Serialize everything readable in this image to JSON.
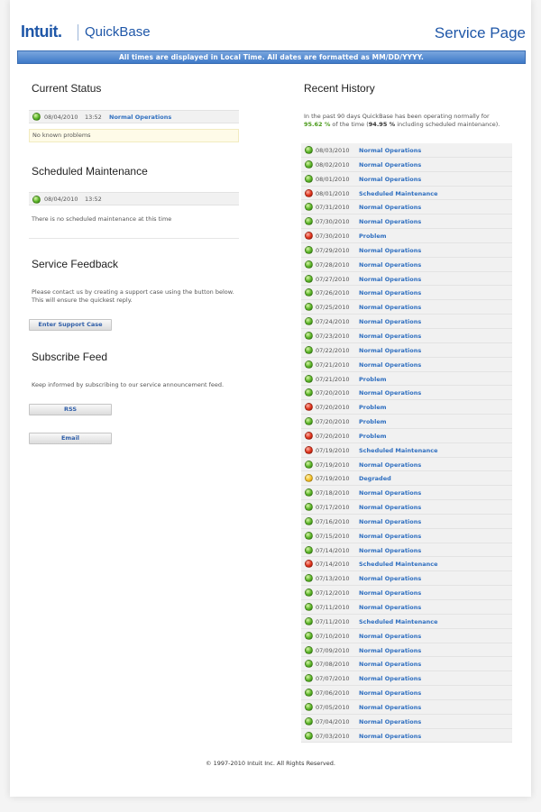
{
  "header": {
    "logo_text": "Intuit.",
    "product_name": "QuickBase",
    "page_title": "Service Page",
    "banner_text": "All times are displayed in Local Time. All dates are formatted as MM/DD/YYYY."
  },
  "current_status": {
    "title": "Current Status",
    "date": "08/04/2010",
    "time": "13:52",
    "status": "Normal Operations",
    "status_color": "green",
    "note": "No known problems"
  },
  "scheduled_maintenance": {
    "title": "Scheduled Maintenance",
    "date": "08/04/2010",
    "time": "13:52",
    "status_color": "green",
    "note": "There is no scheduled maintenance at this time"
  },
  "service_feedback": {
    "title": "Service Feedback",
    "text_line1": "Please contact us by creating a support case using the button below.",
    "text_line2": "This will ensure the quickest reply.",
    "button_label": "Enter Support Case"
  },
  "subscribe_feed": {
    "title": "Subscribe Feed",
    "text": "Keep informed by subscribing to our service announcement feed.",
    "rss_label": "RSS",
    "email_label": "Email"
  },
  "recent_history": {
    "title": "Recent History",
    "summary_prefix": "In the past 90 days QuickBase has been operating normally for",
    "uptime_pct": "95.62 %",
    "summary_mid": "of the time (",
    "uptime_with_maint": "94.95 %",
    "summary_suffix": "including scheduled maintenance).",
    "items": [
      {
        "date": "08/03/2010",
        "status": "Normal Operations",
        "color": "green"
      },
      {
        "date": "08/02/2010",
        "status": "Normal Operations",
        "color": "green"
      },
      {
        "date": "08/01/2010",
        "status": "Normal Operations",
        "color": "green"
      },
      {
        "date": "08/01/2010",
        "status": "Scheduled Maintenance",
        "color": "red"
      },
      {
        "date": "07/31/2010",
        "status": "Normal Operations",
        "color": "green"
      },
      {
        "date": "07/30/2010",
        "status": "Normal Operations",
        "color": "green"
      },
      {
        "date": "07/30/2010",
        "status": "Problem",
        "color": "red"
      },
      {
        "date": "07/29/2010",
        "status": "Normal Operations",
        "color": "green"
      },
      {
        "date": "07/28/2010",
        "status": "Normal Operations",
        "color": "green"
      },
      {
        "date": "07/27/2010",
        "status": "Normal Operations",
        "color": "green"
      },
      {
        "date": "07/26/2010",
        "status": "Normal Operations",
        "color": "green"
      },
      {
        "date": "07/25/2010",
        "status": "Normal Operations",
        "color": "green"
      },
      {
        "date": "07/24/2010",
        "status": "Normal Operations",
        "color": "green"
      },
      {
        "date": "07/23/2010",
        "status": "Normal Operations",
        "color": "green"
      },
      {
        "date": "07/22/2010",
        "status": "Normal Operations",
        "color": "green"
      },
      {
        "date": "07/21/2010",
        "status": "Normal Operations",
        "color": "green"
      },
      {
        "date": "07/21/2010",
        "status": "Problem",
        "color": "green"
      },
      {
        "date": "07/20/2010",
        "status": "Normal Operations",
        "color": "green"
      },
      {
        "date": "07/20/2010",
        "status": "Problem",
        "color": "red"
      },
      {
        "date": "07/20/2010",
        "status": "Problem",
        "color": "green"
      },
      {
        "date": "07/20/2010",
        "status": "Problem",
        "color": "red"
      },
      {
        "date": "07/19/2010",
        "status": "Scheduled Maintenance",
        "color": "red"
      },
      {
        "date": "07/19/2010",
        "status": "Normal Operations",
        "color": "green"
      },
      {
        "date": "07/19/2010",
        "status": "Degraded",
        "color": "yellow"
      },
      {
        "date": "07/18/2010",
        "status": "Normal Operations",
        "color": "green"
      },
      {
        "date": "07/17/2010",
        "status": "Normal Operations",
        "color": "green"
      },
      {
        "date": "07/16/2010",
        "status": "Normal Operations",
        "color": "green"
      },
      {
        "date": "07/15/2010",
        "status": "Normal Operations",
        "color": "green"
      },
      {
        "date": "07/14/2010",
        "status": "Normal Operations",
        "color": "green"
      },
      {
        "date": "07/14/2010",
        "status": "Scheduled Maintenance",
        "color": "red"
      },
      {
        "date": "07/13/2010",
        "status": "Normal Operations",
        "color": "green"
      },
      {
        "date": "07/12/2010",
        "status": "Normal Operations",
        "color": "green"
      },
      {
        "date": "07/11/2010",
        "status": "Normal Operations",
        "color": "green"
      },
      {
        "date": "07/11/2010",
        "status": "Scheduled Maintenance",
        "color": "green"
      },
      {
        "date": "07/10/2010",
        "status": "Normal Operations",
        "color": "green"
      },
      {
        "date": "07/09/2010",
        "status": "Normal Operations",
        "color": "green"
      },
      {
        "date": "07/08/2010",
        "status": "Normal Operations",
        "color": "green"
      },
      {
        "date": "07/07/2010",
        "status": "Normal Operations",
        "color": "green"
      },
      {
        "date": "07/06/2010",
        "status": "Normal Operations",
        "color": "green"
      },
      {
        "date": "07/05/2010",
        "status": "Normal Operations",
        "color": "green"
      },
      {
        "date": "07/04/2010",
        "status": "Normal Operations",
        "color": "green"
      },
      {
        "date": "07/03/2010",
        "status": "Normal Operations",
        "color": "green"
      }
    ]
  },
  "footer": {
    "copyright": "© 1997-2010 Intuit Inc. All Rights Reserved."
  }
}
